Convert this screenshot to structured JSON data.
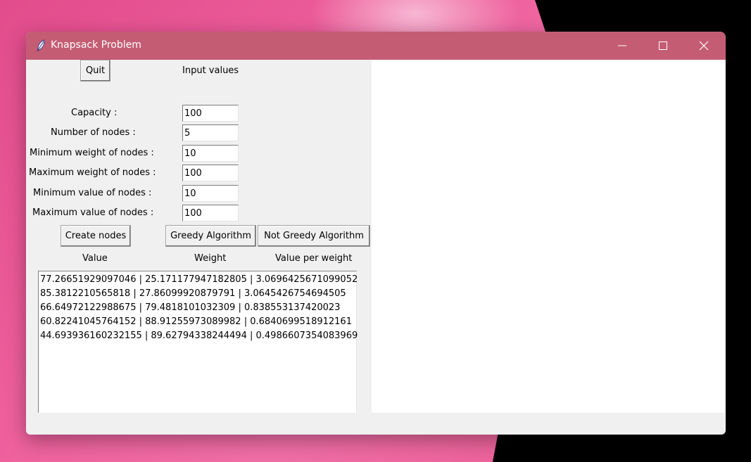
{
  "window": {
    "title": "Knapsack Problem",
    "titlebar_color": "#c45d73",
    "controls": [
      "minimize-icon",
      "maximize-icon",
      "close-icon"
    ]
  },
  "buttons": {
    "quit": "Quit",
    "create_nodes": "Create nodes",
    "greedy": "Greedy Algorithm",
    "not_greedy": "Not Greedy Algorithm"
  },
  "input_header": "Input values",
  "fields": [
    {
      "label": "Capacity :",
      "value": "100"
    },
    {
      "label": "Number of nodes :",
      "value": "5"
    },
    {
      "label": "Minimum weight of nodes :",
      "value": "10"
    },
    {
      "label": "Maximum weight of nodes :",
      "value": "100"
    },
    {
      "label": "Minimum value of nodes :",
      "value": "10"
    },
    {
      "label": "Maximum value of nodes :",
      "value": "100"
    }
  ],
  "columns": [
    "Value",
    "Weight",
    "Value per weight"
  ],
  "rows": [
    "77.26651929097046 | 25.171177947182805 | 3.0696425671099052",
    "85.3812210565818 | 27.86099920879791 | 3.0645426754694505",
    "66.64972122988675 | 79.4818101032309 | 0.838553137420023",
    "60.82241045764152 | 88.91255973089982 | 0.6840699518912161",
    "44.693936160232155 | 89.62794338244494 | 0.4986607354083969"
  ]
}
